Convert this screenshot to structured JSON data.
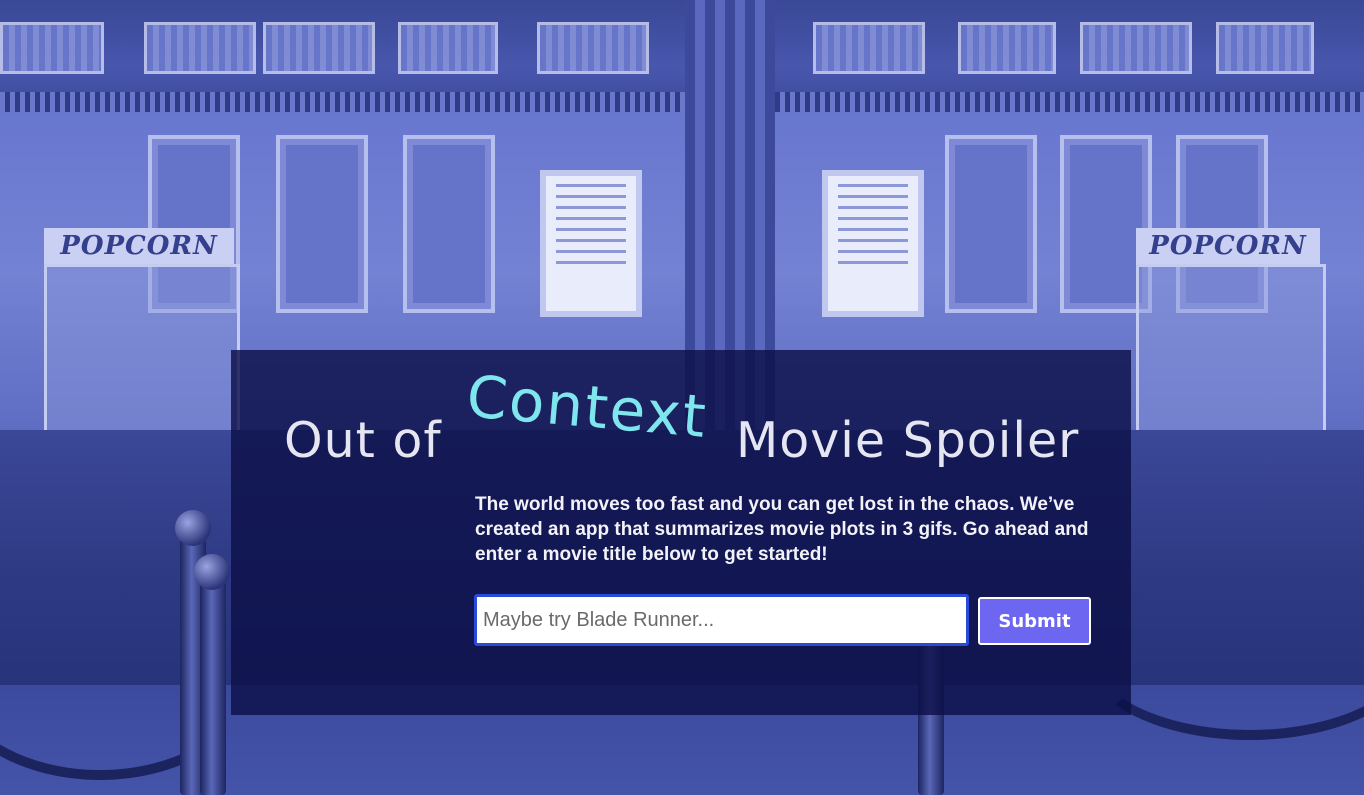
{
  "background": {
    "signs": {
      "left_popcorn": "POPCORN",
      "right_popcorn": "POPCORN"
    }
  },
  "hero": {
    "title_prefix": "Out of",
    "title_accent": "Context",
    "title_suffix": "Movie Spoiler",
    "description": "The world moves too fast and you can get lost in the chaos. We’ve created an app that summarizes movie plots in 3 gifs. Go ahead and enter a movie title below to get started!"
  },
  "search": {
    "placeholder": "Maybe try Blade Runner...",
    "value": "",
    "submit_label": "Submit"
  },
  "colors": {
    "overlay": "#0c1048",
    "accent_title": "#7fe6ee",
    "submit_button": "#6d66f0",
    "input_border": "#2a4bd8"
  }
}
